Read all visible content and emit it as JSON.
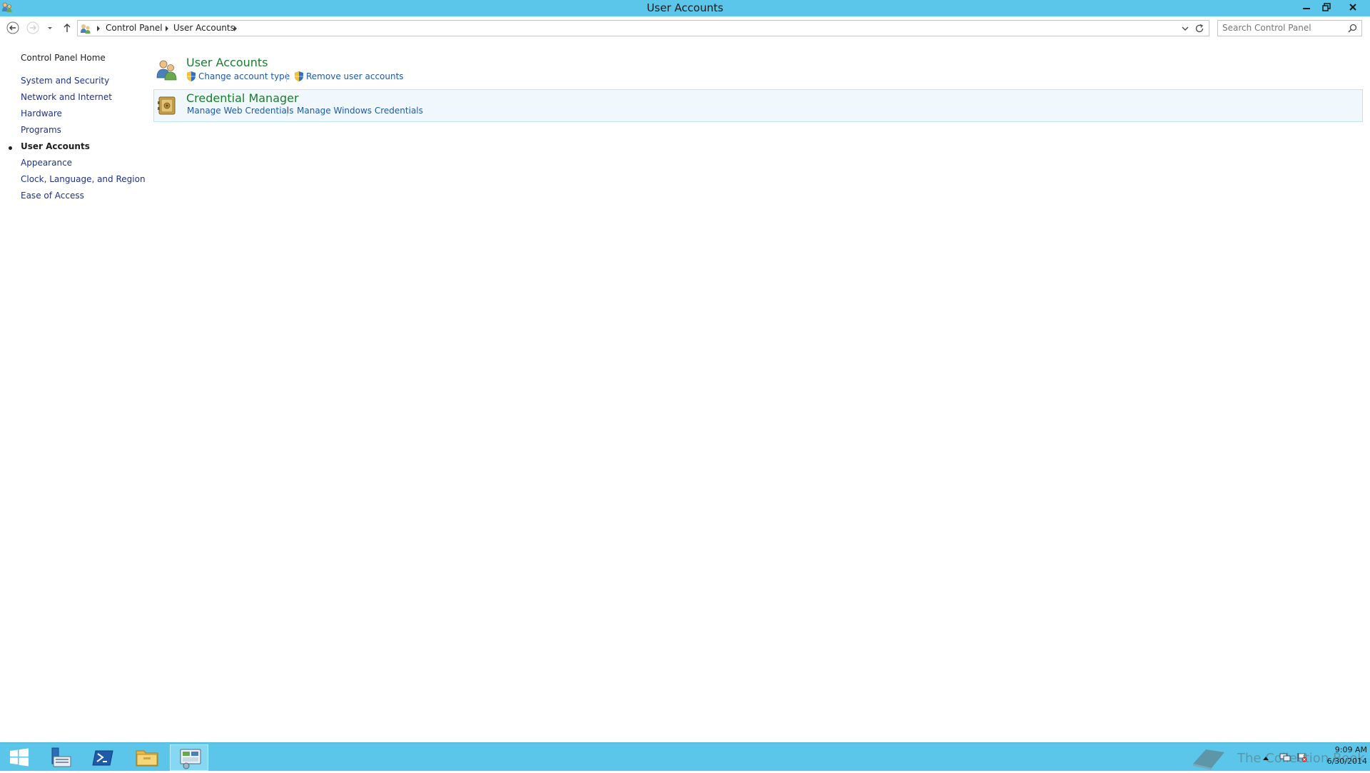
{
  "window": {
    "title": "User Accounts",
    "icon": "user-accounts-icon",
    "controls": [
      "minimize-icon",
      "restore-icon",
      "close-icon"
    ]
  },
  "navigation": {
    "breadcrumbs": [
      "Control Panel",
      "User Accounts"
    ],
    "search_placeholder": "Search Control Panel"
  },
  "sidebar": {
    "home": "Control Panel Home",
    "items": [
      {
        "label": "System and Security",
        "active": false
      },
      {
        "label": "Network and Internet",
        "active": false
      },
      {
        "label": "Hardware",
        "active": false
      },
      {
        "label": "Programs",
        "active": false
      },
      {
        "label": "User Accounts",
        "active": true
      },
      {
        "label": "Appearance",
        "active": false
      },
      {
        "label": "Clock, Language, and Region",
        "active": false
      },
      {
        "label": "Ease of Access",
        "active": false
      }
    ]
  },
  "categories": [
    {
      "title": "User Accounts",
      "icon": "users-icon",
      "tasks": [
        {
          "label": "Change account type",
          "shield": true
        },
        {
          "label": "Remove user accounts",
          "shield": true
        }
      ]
    },
    {
      "title": "Credential Manager",
      "icon": "credential-vault-icon",
      "highlighted": true,
      "tasks": [
        {
          "label": "Manage Web Credentials",
          "shield": false
        },
        {
          "label": "Manage Windows Credentials",
          "shield": false
        }
      ]
    }
  ],
  "taskbar": {
    "pinned": [
      "start-icon",
      "server-manager-icon",
      "powershell-icon",
      "file-explorer-icon",
      "control-panel-icon"
    ],
    "active": "control-panel-icon",
    "watermark": "The Collection Book",
    "clock_time": "9:09 AM",
    "clock_date": "6/30/2014"
  },
  "colors": {
    "chrome": "#5cc6ea",
    "category_title": "#1b7c2e",
    "task_link": "#1e5aa8",
    "nav_link": "#1e3287",
    "highlight_bg": "#f1f8fd",
    "highlight_border": "#bfe3f4"
  }
}
